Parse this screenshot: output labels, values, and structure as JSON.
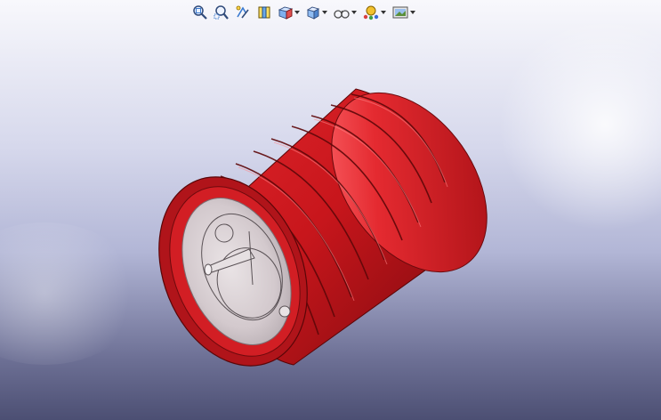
{
  "toolbar": {
    "items": [
      {
        "id": "zoom-to-fit",
        "icon": "zoom-to-fit-icon",
        "dropdown": false
      },
      {
        "id": "zoom-to-area",
        "icon": "zoom-to-area-icon",
        "dropdown": false
      },
      {
        "id": "previous-view",
        "icon": "previous-view-icon",
        "dropdown": false
      },
      {
        "id": "section-view",
        "icon": "section-view-icon",
        "dropdown": false
      },
      {
        "id": "view-orientation",
        "icon": "view-orientation-icon",
        "dropdown": true
      },
      {
        "id": "display-style",
        "icon": "display-style-icon",
        "dropdown": true
      },
      {
        "id": "hide-show-items",
        "icon": "hide-show-items-icon",
        "dropdown": true
      },
      {
        "id": "edit-appearance",
        "icon": "edit-appearance-icon",
        "dropdown": true
      },
      {
        "id": "apply-scene",
        "icon": "apply-scene-icon",
        "dropdown": true
      }
    ]
  },
  "colors": {
    "part": "#c8161c",
    "part_dark": "#7a0a0e",
    "part_light": "#f25a5e",
    "glass": "#d8d0d4"
  }
}
